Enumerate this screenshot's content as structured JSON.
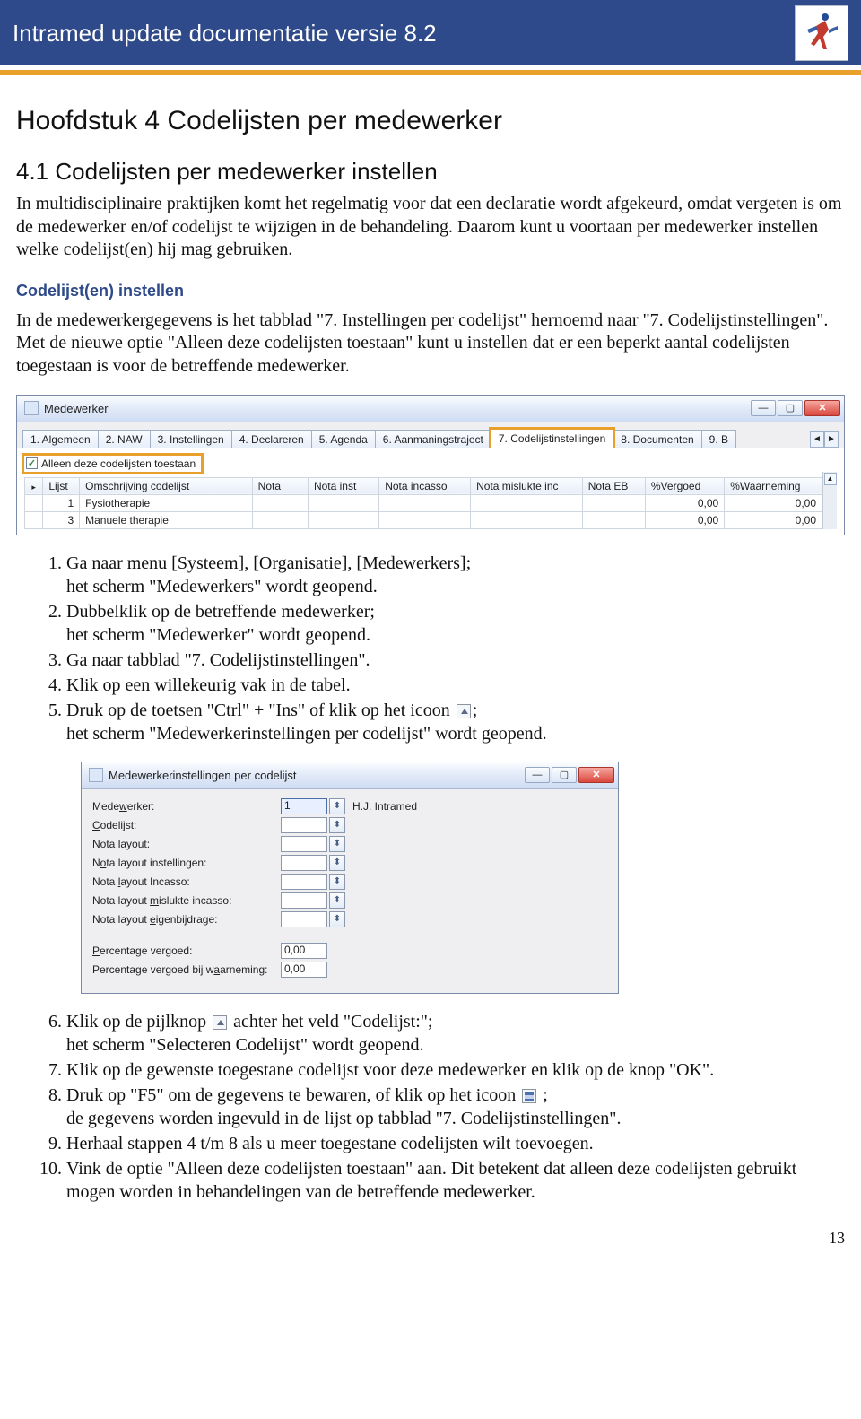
{
  "banner": {
    "title": "Intramed update documentatie versie 8.2"
  },
  "chapter": "Hoofdstuk 4  Codelijsten per medewerker",
  "section": "4.1 Codelijsten per medewerker instellen",
  "para1": "In multidisciplinaire praktijken komt het regelmatig voor dat een declaratie wordt afgekeurd, omdat vergeten is om de medewerker en/of codelijst te wijzigen in de behandeling. Daarom kunt u voortaan per medewerker instellen welke codelijst(en) hij mag gebruiken.",
  "sub1": "Codelijst(en) instellen",
  "para2": "In de medewerkergegevens is het tabblad \"7. Instellingen per codelijst\" hernoemd naar \"7. Codelijstinstellingen\". Met de nieuwe optie \"Alleen deze codelijsten toestaan\" kunt u instellen dat er een beperkt aantal codelijsten toegestaan is voor de betreffende medewerker.",
  "screenshot1": {
    "title": "Medewerker",
    "tabs": [
      "1. Algemeen",
      "2. NAW",
      "3. Instellingen",
      "4. Declareren",
      "5. Agenda",
      "6. Aanmaningstraject",
      "7. Codelijstinstellingen",
      "8. Documenten",
      "9. B"
    ],
    "highlight_tab_index": 6,
    "checkbox_label": "Alleen deze codelijsten toestaan",
    "checkbox_checked": true,
    "columns": [
      "",
      "Lijst",
      "Omschrijving codelijst",
      "Nota",
      "Nota inst",
      "Nota incasso",
      "Nota mislukte inc",
      "Nota EB",
      "%Vergoed",
      "%Waarneming"
    ],
    "rows": [
      {
        "lijst": "1",
        "omschrijving": "Fysiotherapie",
        "nota": "",
        "notainst": "",
        "notaincasso": "",
        "notamislukte": "",
        "notaeb": "",
        "vergoed": "0,00",
        "waarneming": "0,00"
      },
      {
        "lijst": "3",
        "omschrijving": "Manuele therapie",
        "nota": "",
        "notainst": "",
        "notaincasso": "",
        "notamislukte": "",
        "notaeb": "",
        "vergoed": "0,00",
        "waarneming": "0,00"
      }
    ]
  },
  "steps_a": [
    {
      "n": "1.",
      "t": "Ga naar menu [Systeem], [Organisatie], [Medewerkers];",
      "c": "het scherm \"Medewerkers\" wordt geopend."
    },
    {
      "n": "2.",
      "t": "Dubbelklik op de betreffende medewerker;",
      "c": "het scherm \"Medewerker\" wordt geopend."
    },
    {
      "n": "3.",
      "t": "Ga naar tabblad \"7. Codelijstinstellingen\"."
    },
    {
      "n": "4.",
      "t": "Klik op een willekeurig vak in de tabel."
    },
    {
      "n": "5.",
      "t": "Druk op de toetsen \"Ctrl\" + \"Ins\" of klik op het icoon",
      "icon": "insert-icon",
      "after": ";",
      "c": "het scherm \"Medewerkerinstellingen per codelijst\" wordt geopend."
    }
  ],
  "screenshot2": {
    "title": "Medewerkerinstellingen per codelijst",
    "fields": [
      {
        "label_pre": "Mede",
        "label_u": "w",
        "label_post": "erker:",
        "value": "1",
        "after": "H.J. Intramed",
        "selected": true
      },
      {
        "label_pre": "",
        "label_u": "C",
        "label_post": "odelijst:",
        "value": ""
      },
      {
        "label_pre": "",
        "label_u": "N",
        "label_post": "ota layout:",
        "value": ""
      },
      {
        "label_pre": "N",
        "label_u": "o",
        "label_post": "ta layout instellingen:",
        "value": ""
      },
      {
        "label_pre": "Nota ",
        "label_u": "l",
        "label_post": "ayout Incasso:",
        "value": ""
      },
      {
        "label_pre": "Nota layout ",
        "label_u": "m",
        "label_post": "islukte incasso:",
        "value": ""
      },
      {
        "label_pre": "Nota layout ",
        "label_u": "e",
        "label_post": "igenbijdrage:",
        "value": ""
      }
    ],
    "percent_fields": [
      {
        "label_pre": "",
        "label_u": "P",
        "label_post": "ercentage vergoed:",
        "value": "0,00"
      },
      {
        "label_pre": "Percentage vergoed bij w",
        "label_u": "a",
        "label_post": "arneming:",
        "value": "0,00"
      }
    ]
  },
  "steps_b": [
    {
      "n": "6.",
      "t": "Klik op de pijlknop",
      "icon": "picker-icon",
      "after": " achter het veld \"Codelijst:\";",
      "c": "het scherm \"Selecteren Codelijst\" wordt geopend."
    },
    {
      "n": "7.",
      "t": "Klik op de gewenste toegestane codelijst voor deze medewerker en klik op de knop  \"OK\"."
    },
    {
      "n": "8.",
      "t": "Druk op \"F5\" om de gegevens te bewaren, of klik op het icoon",
      "icon": "save-icon",
      "after": " ;",
      "c": "de gegevens worden ingevuld in de lijst op tabblad \"7. Codelijstinstellingen\"."
    },
    {
      "n": "9.",
      "t": "Herhaal stappen 4 t/m 8 als u meer toegestane codelijsten wilt toevoegen."
    },
    {
      "n": "10.",
      "t": "Vink de optie \"Alleen deze codelijsten toestaan\" aan. Dit betekent dat alleen deze codelijsten gebruikt mogen worden in behandelingen van de betreffende medewerker."
    }
  ],
  "page_number": "13"
}
